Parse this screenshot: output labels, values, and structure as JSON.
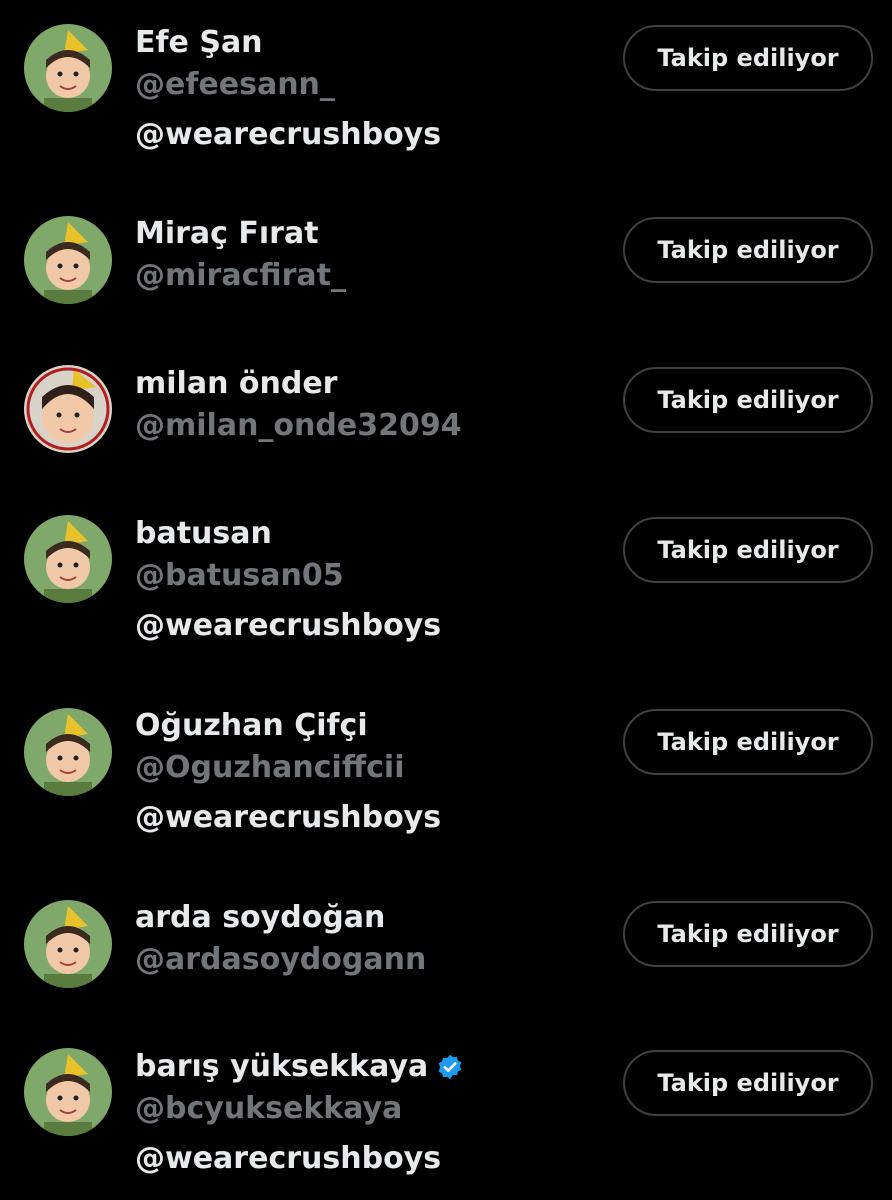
{
  "follow_button_label": "Takip ediliyor",
  "colors": {
    "background": "#000000",
    "primary_text": "#e7e9ea",
    "secondary_text": "#71767b",
    "button_border": "#3e4144",
    "verified_badge": "#1d9bf0"
  },
  "users": [
    {
      "name": "Efe Şan",
      "handle": "@efeesann_",
      "bio": "@wearecrushboys",
      "verified": false,
      "avatar_icon": "child-photo-avatar"
    },
    {
      "name": "Miraç Fırat",
      "handle": "@miracfirat_",
      "bio": "",
      "verified": false,
      "avatar_icon": "child-photo-avatar"
    },
    {
      "name": "milan önder",
      "handle": "@milan_onde32094",
      "bio": "",
      "verified": false,
      "avatar_icon": "child-photo-avatar"
    },
    {
      "name": "batusan",
      "handle": "@batusan05",
      "bio": "@wearecrushboys",
      "verified": false,
      "avatar_icon": "child-photo-avatar"
    },
    {
      "name": "Oğuzhan Çifçi",
      "handle": "@Oguzhanciffcii",
      "bio": "@wearecrushboys",
      "verified": false,
      "avatar_icon": "child-photo-avatar"
    },
    {
      "name": "arda soydoğan",
      "handle": "@ardasoydogann",
      "bio": "",
      "verified": false,
      "avatar_icon": "child-photo-avatar"
    },
    {
      "name": "barış yüksekkaya",
      "handle": "@bcyuksekkaya",
      "bio": "@wearecrushboys",
      "verified": true,
      "avatar_icon": "child-photo-avatar"
    }
  ]
}
